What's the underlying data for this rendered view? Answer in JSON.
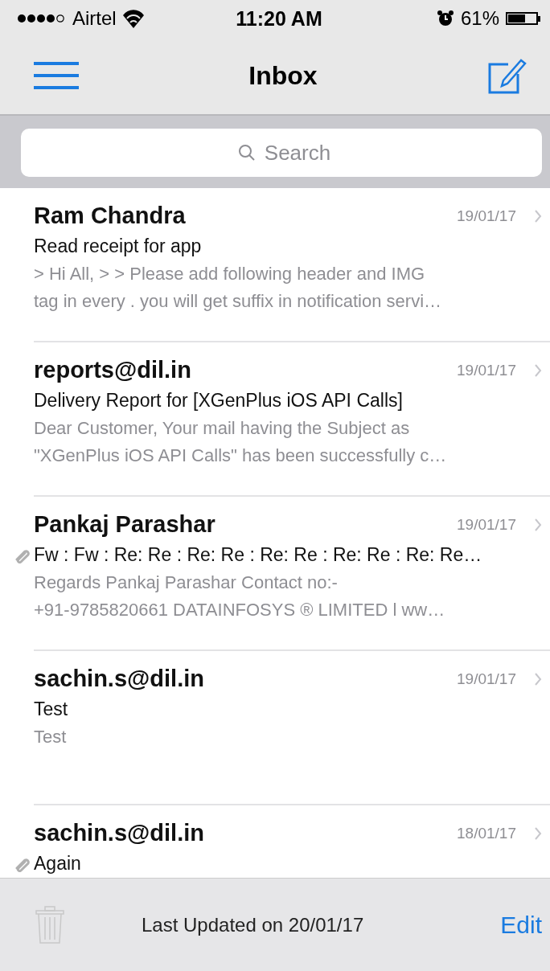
{
  "status_bar": {
    "carrier": "Airtel",
    "time": "11:20 AM",
    "battery_text": "61%"
  },
  "nav": {
    "title": "Inbox"
  },
  "search": {
    "placeholder": "Search"
  },
  "messages": [
    {
      "sender": "Ram Chandra",
      "date": "19/01/17",
      "subject": "Read receipt for app",
      "attachment": false,
      "preview_lines": [
        "> Hi All, > > Please add following header and IMG",
        "tag in every . you will get suffix in notification servi…"
      ]
    },
    {
      "sender": "reports@dil.in",
      "date": "19/01/17",
      "subject": "Delivery Report for [XGenPlus iOS API Calls]",
      "attachment": false,
      "preview_lines": [
        "Dear Customer, Your mail having the Subject as",
        "\"XGenPlus iOS API Calls\" has been successfully c…"
      ]
    },
    {
      "sender": "Pankaj Parashar",
      "date": "19/01/17",
      "subject": "Fw : Fw : Re: Re : Re: Re : Re: Re : Re: Re : Re: Re…",
      "attachment": true,
      "preview_lines": [
        "Regards Pankaj Parashar Contact no:-",
        "+91-9785820661 DATAINFOSYS ® LIMITED l ww…"
      ]
    },
    {
      "sender": "sachin.s@dil.in",
      "date": "19/01/17",
      "subject": "Test",
      "attachment": false,
      "preview_lines": [
        "Test"
      ]
    },
    {
      "sender": "sachin.s@dil.in",
      "date": "18/01/17",
      "subject": "Again",
      "attachment": true
    }
  ],
  "toolbar": {
    "trash_disabled": true,
    "status": "Last Updated on 20/01/17",
    "edit": "Edit"
  }
}
